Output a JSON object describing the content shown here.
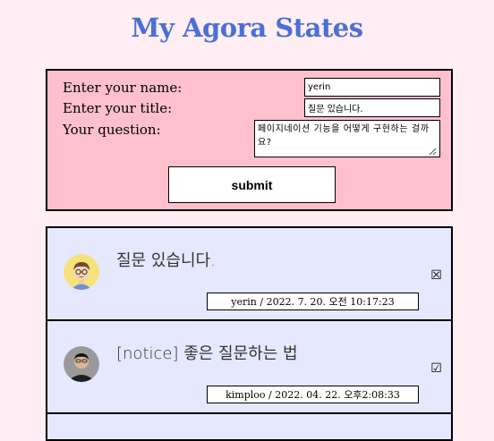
{
  "page": {
    "title": "My Agora States"
  },
  "form": {
    "name_label": "Enter your name:",
    "name_value": "yerin",
    "title_label": "Enter your title:",
    "title_value": "질문 있습니다.",
    "question_label": "Your question:",
    "question_value": "페이지네이션 기능을 어떻게 구현하는 걸까요?",
    "submit_label": "submit"
  },
  "discussions": [
    {
      "title": "질문 있습니다.",
      "meta": "yerin / 2022. 7. 20. 오전 10:17:23",
      "answered": false,
      "checkbox_glyph": "☒",
      "avatar": "cartoon-avatar-icon"
    },
    {
      "title": "[notice] 좋은 질문하는 법",
      "meta": "kimploo / 2022. 04. 22. 오후2:08:33",
      "answered": true,
      "checkbox_glyph": "☑",
      "avatar": "photo-avatar"
    }
  ],
  "colors": {
    "background": "#ffeef4",
    "title": "#4b6fd6",
    "form_bg": "#ffc0cd",
    "list_bg": "#e6e8ff"
  }
}
